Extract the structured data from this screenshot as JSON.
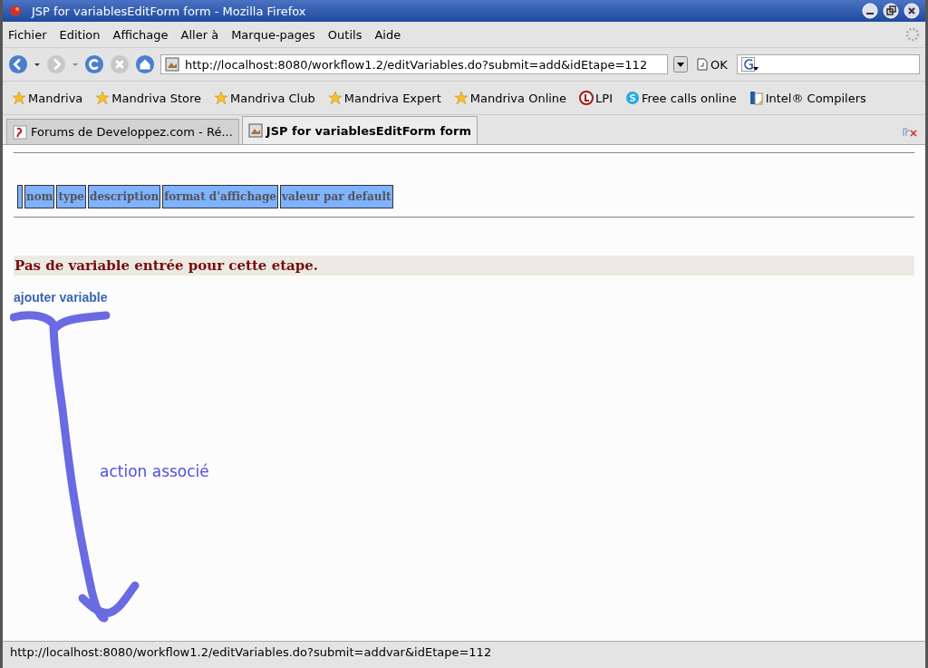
{
  "window": {
    "title": "JSP for variablesEditForm form - Mozilla Firefox"
  },
  "menu": [
    "Fichier",
    "Edition",
    "Affichage",
    "Aller à",
    "Marque-pages",
    "Outils",
    "Aide"
  ],
  "toolbar": {
    "url": "http://localhost:8080/workflow1.2/editVariables.do?submit=add&idEtape=112",
    "go_label": "OK"
  },
  "bookmarks": [
    {
      "label": "Mandriva",
      "kind": "star"
    },
    {
      "label": "Mandriva Store",
      "kind": "star"
    },
    {
      "label": "Mandriva Club",
      "kind": "star"
    },
    {
      "label": "Mandriva Expert",
      "kind": "star"
    },
    {
      "label": "Mandriva Online",
      "kind": "star"
    },
    {
      "label": "LPI",
      "kind": "lpi"
    },
    {
      "label": "Free calls online",
      "kind": "skype"
    },
    {
      "label": "Intel® Compilers",
      "kind": "intel"
    }
  ],
  "tabs": [
    {
      "label": "Forums de Developpez.com - Ré...",
      "selected": false
    },
    {
      "label": "JSP for variablesEditForm form",
      "selected": true
    }
  ],
  "page": {
    "table_headers": [
      "nom",
      "type",
      "description",
      "format d'affichage",
      "valeur par default"
    ],
    "message": "Pas de variable entrée pour cette etape.",
    "link": "ajouter variable",
    "annotation": "action associé"
  },
  "status_bar": "http://localhost:8080/workflow1.2/editVariables.do?submit=addvar&idEtape=112"
}
